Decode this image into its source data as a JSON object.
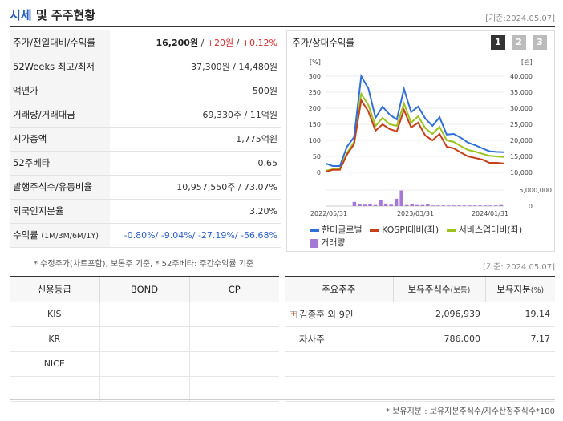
{
  "header": {
    "title_part1": "시세",
    "title_part2": " 및 주주현황",
    "date": "[기준:2024.05.07]"
  },
  "stats": [
    {
      "label": "주가/전일대비/수익률",
      "value_main": "16,200원",
      "sep1": " / ",
      "value_change": "+20원",
      "sep2": " / ",
      "value_pct": "+0.12%"
    },
    {
      "label": "52Weeks 최고/최저",
      "value": "37,300원 / 14,480원"
    },
    {
      "label": "액면가",
      "value": "500원"
    },
    {
      "label": "거래량/거래대금",
      "value": "69,330주 / 11억원"
    },
    {
      "label": "시가총액",
      "value": "1,775억원"
    },
    {
      "label": "52주베타",
      "value": "0.65"
    },
    {
      "label": "발행주식수/유동비율",
      "value": "10,957,550주 / 73.07%"
    },
    {
      "label": "외국인지분율",
      "value": "3.20%"
    },
    {
      "label": "수익률",
      "label_small": "(1M/3M/6M/1Y)",
      "returns": [
        "-0.80%",
        "-9.04%",
        "-27.19%",
        "-56.68%"
      ]
    }
  ],
  "note1": "* 수정주가(차트포함), 보통주 기준, * 52주베타: 주간수익률 기준",
  "chart": {
    "title": "주가/상대수익률",
    "page_buttons": [
      "1",
      "2",
      "3"
    ],
    "left_unit": "[%]",
    "right_unit": "[원]",
    "legend": [
      "한미글로벌",
      "KOSPI대비(좌)",
      "서비스업대비(좌)",
      "거래량"
    ],
    "colors": {
      "stock": "#2f6fd6",
      "kospi": "#c8401a",
      "service": "#9cc21c",
      "volume": "#a57ad6"
    }
  },
  "chart_data": {
    "type": "line",
    "x_ticks": [
      "2022/05/31",
      "2023/03/31",
      "2024/01/31"
    ],
    "y_left_ticks": [
      "300",
      "250",
      "200",
      "150",
      "100",
      "50",
      "0"
    ],
    "y_right_ticks": [
      "40,000",
      "35,000",
      "30,000",
      "25,000",
      "20,000",
      "15,000",
      "10,000"
    ],
    "y_left_range": [
      0,
      300
    ],
    "volume_ticks": [
      "5,000,000",
      "0"
    ],
    "series": [
      {
        "name": "한미글로벌",
        "values": [
          28,
          20,
          20,
          80,
          110,
          300,
          262,
          170,
          205,
          180,
          165,
          260,
          188,
          205,
          168,
          145,
          172,
          118,
          120,
          108,
          93,
          85,
          75,
          66,
          64,
          63
        ]
      },
      {
        "name": "KOSPI대비(좌)",
        "values": [
          2,
          8,
          8,
          55,
          88,
          225,
          190,
          130,
          150,
          135,
          128,
          195,
          140,
          155,
          115,
          100,
          120,
          80,
          75,
          62,
          50,
          45,
          40,
          30,
          30,
          28
        ]
      },
      {
        "name": "서비스업대비(좌)",
        "values": [
          5,
          10,
          12,
          60,
          95,
          245,
          210,
          145,
          170,
          150,
          145,
          215,
          155,
          175,
          138,
          120,
          142,
          100,
          95,
          82,
          70,
          65,
          58,
          52,
          50,
          48
        ]
      }
    ],
    "volume": [
      0,
      0,
      0,
      0,
      0,
      0.2,
      0.08,
      0.07,
      0.12,
      0.05,
      0.28,
      0.12,
      0.07,
      0.35,
      0.75,
      0.05,
      0.1,
      0.05,
      0.05,
      0.1,
      0.03,
      0.03,
      0.03,
      0.03,
      0.03,
      0.03,
      0.03,
      0.03,
      0.03,
      0.03,
      0.03,
      0.03,
      0.03,
      0.05
    ]
  },
  "date2": "[기준: 2024.05.07]",
  "credit": {
    "headers": [
      "신용등급",
      "BOND",
      "CP"
    ],
    "rows": [
      [
        "KIS",
        "",
        ""
      ],
      [
        "KR",
        "",
        ""
      ],
      [
        "NICE",
        "",
        ""
      ],
      [
        "",
        "",
        ""
      ]
    ]
  },
  "holders": {
    "headers": [
      "주요주주",
      "보유주식수",
      "(보통)",
      "보유지분",
      "(%)"
    ],
    "rows": [
      {
        "name": "김종훈 외 9인",
        "shares": "2,096,939",
        "pct": "19.14"
      },
      {
        "name": "자사주",
        "shares": "786,000",
        "pct": "7.17"
      },
      {
        "name": "",
        "shares": "",
        "pct": ""
      },
      {
        "name": "",
        "shares": "",
        "pct": ""
      }
    ]
  },
  "note2": "* 보유지분 : 보유지분주식수/지수산정주식수*100"
}
